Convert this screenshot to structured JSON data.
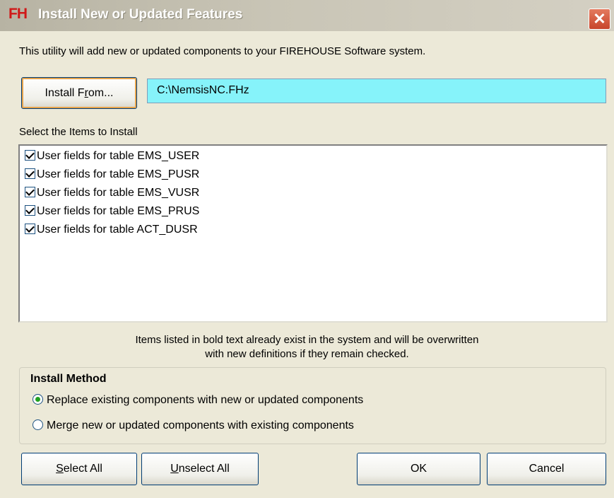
{
  "window": {
    "logo": "FH",
    "title": "Install New or Updated Features",
    "close_symbol": "✕"
  },
  "intro": "This utility will add new or updated components to your FIREHOUSE Software system.",
  "install_from": {
    "label_prefix": "Install F",
    "label_accel": "r",
    "label_suffix": "om...",
    "path": "C:\\NemsisNC.FHz"
  },
  "list": {
    "label": "Select the Items to Install",
    "items": [
      {
        "label": "User fields for table EMS_USER",
        "checked": true
      },
      {
        "label": "User fields for table EMS_PUSR",
        "checked": true
      },
      {
        "label": "User fields for table EMS_VUSR",
        "checked": true
      },
      {
        "label": "User fields for table EMS_PRUS",
        "checked": true
      },
      {
        "label": "User fields for table ACT_DUSR",
        "checked": true
      }
    ]
  },
  "note": {
    "line1": "Items listed in bold text already exist in the system and will be overwritten",
    "line2": "with new definitions if they remain checked."
  },
  "install_method": {
    "title": "Install Method",
    "options": [
      {
        "label": "Replace existing components with new or updated components",
        "selected": true
      },
      {
        "label": "Merge new or updated components with existing components",
        "selected": false
      }
    ]
  },
  "buttons": {
    "select_all_accel": "S",
    "select_all_rest": "elect All",
    "unselect_all_accel": "U",
    "unselect_all_rest": "nselect All",
    "ok": "OK",
    "cancel": "Cancel"
  }
}
